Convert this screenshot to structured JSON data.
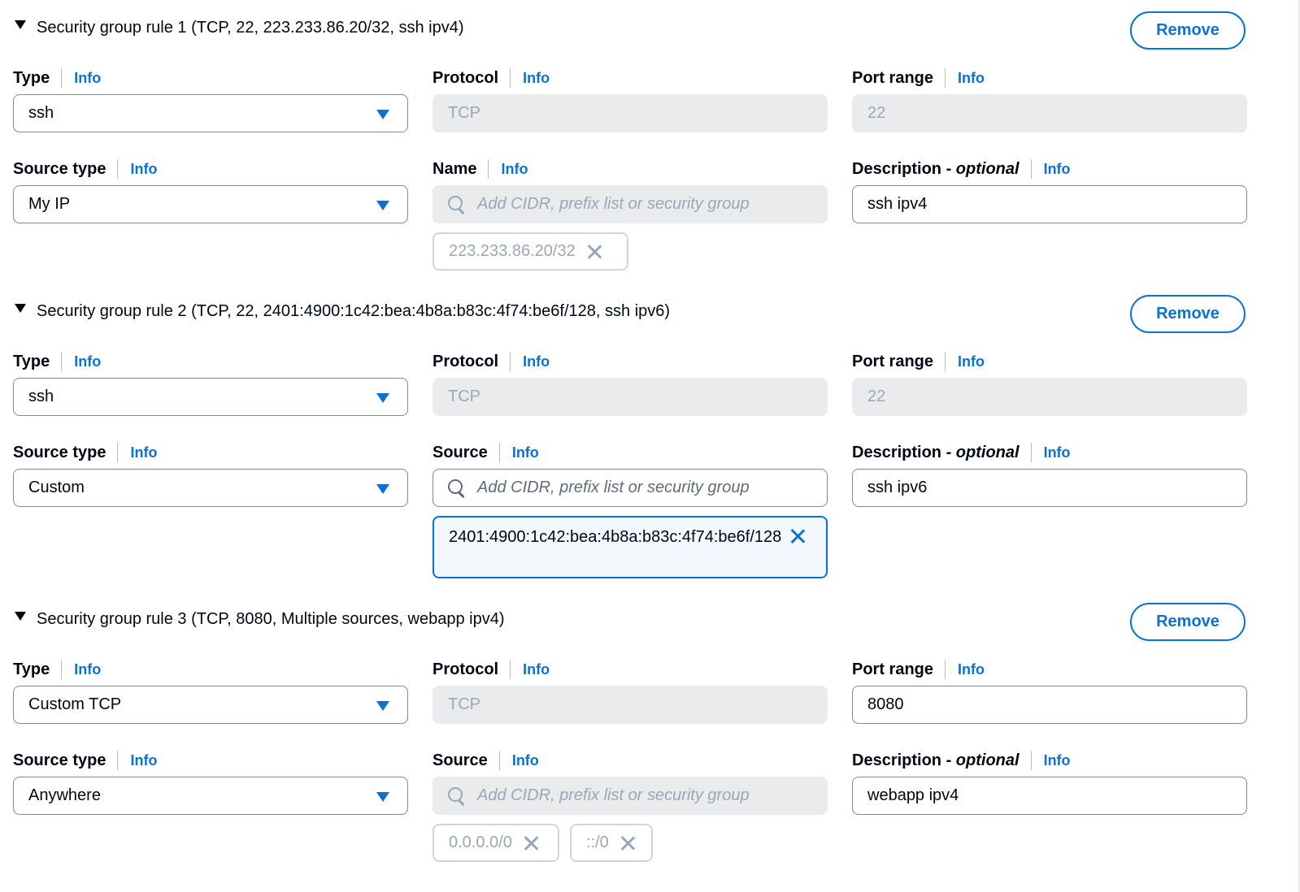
{
  "common": {
    "info": "Info",
    "remove": "Remove",
    "labels": {
      "type": "Type",
      "protocol": "Protocol",
      "port_range": "Port range",
      "source_type": "Source type",
      "name": "Name",
      "source": "Source",
      "description": "Description - ",
      "optional": "optional"
    },
    "search_placeholder": "Add CIDR, prefix list or security group"
  },
  "rules": [
    {
      "title": "Security group rule 1 (TCP, 22, 223.233.86.20/32, ssh ipv4)",
      "type": "ssh",
      "protocol": "TCP",
      "port_range": "22",
      "source_type": "My IP",
      "source_label": "Name",
      "description": "ssh ipv4",
      "tokens": [
        "223.233.86.20/32"
      ]
    },
    {
      "title": "Security group rule 2 (TCP, 22, 2401:4900:1c42:bea:4b8a:b83c:4f74:be6f/128, ssh ipv6)",
      "type": "ssh",
      "protocol": "TCP",
      "port_range": "22",
      "source_type": "Custom",
      "source_label": "Source",
      "description": "ssh ipv6",
      "tokens": [
        "2401:4900:1c42:bea:4b8a:b83c:4f74:be6f/128"
      ]
    },
    {
      "title": "Security group rule 3 (TCP, 8080, Multiple sources, webapp ipv4)",
      "type": "Custom TCP",
      "protocol": "TCP",
      "port_range": "8080",
      "source_type": "Anywhere",
      "source_label": "Source",
      "description": "webapp ipv4",
      "tokens": [
        "0.0.0.0/0",
        "::/0"
      ]
    }
  ],
  "colors": {
    "accent": "#0972d3",
    "disabled_bg": "#e9ebed",
    "border": "#7d8998"
  }
}
